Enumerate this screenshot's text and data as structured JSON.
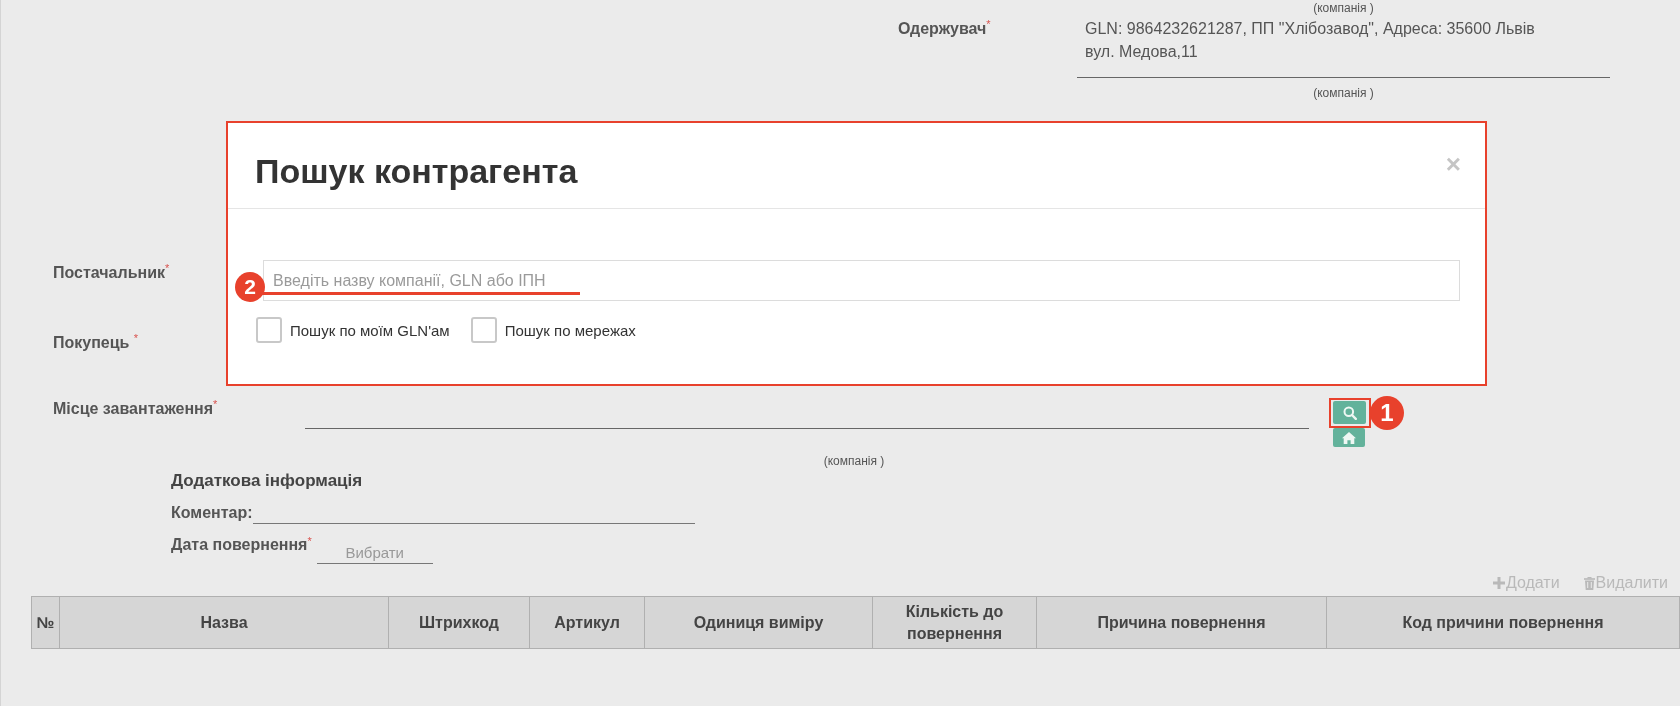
{
  "top_caption": "(компанія )",
  "receiver": {
    "label": "Одержувач$^{*}$",
    "value": "GLN: 9864232621287, ПП \"Хлібозавод\", Адреса: 35600 Львів вул. Медова,11",
    "caption": "(компанія )"
  },
  "dialog": {
    "title": "Пошук контрагента",
    "close": "×",
    "highlighted": true,
    "search_field": {
      "placeholder": "Введіть назву компанії, GLN або ІПН",
      "highlighted": true,
      "marker": "2"
    },
    "options": [
      {
        "label": "Пошук по моїм GLN'ам",
        "checked": false
      },
      {
        "label": "Пошук по мережах",
        "checked": false
      }
    ]
  },
  "parties": [
    {
      "label": "Постачальник$^{*}$"
    },
    {
      "label": "Покупець $^{*}$"
    }
  ],
  "loading_place": {
    "label": "Місце завантаження$^{*}$",
    "caption": "(компанія )",
    "search_button": {
      "highlighted": true,
      "marker": "1"
    }
  },
  "additional_info": {
    "title": "Додаткова інформація",
    "comment_label": "Коментар:",
    "return_date_label": "Дата повернення$^{*}$",
    "return_date_placeholder": "Вибрати"
  },
  "table_actions": [
    {
      "kind": "add",
      "label": "Додати",
      "disabled": true
    },
    {
      "kind": "delete",
      "label": "Видалити",
      "disabled": true
    }
  ],
  "table": {
    "columns": [
      "№",
      "Назва",
      "Штрихкод",
      "Артикул",
      "Одиниця виміру",
      "Кількість до повернення",
      "Причина повернення",
      "Код причини повернення"
    ]
  }
}
